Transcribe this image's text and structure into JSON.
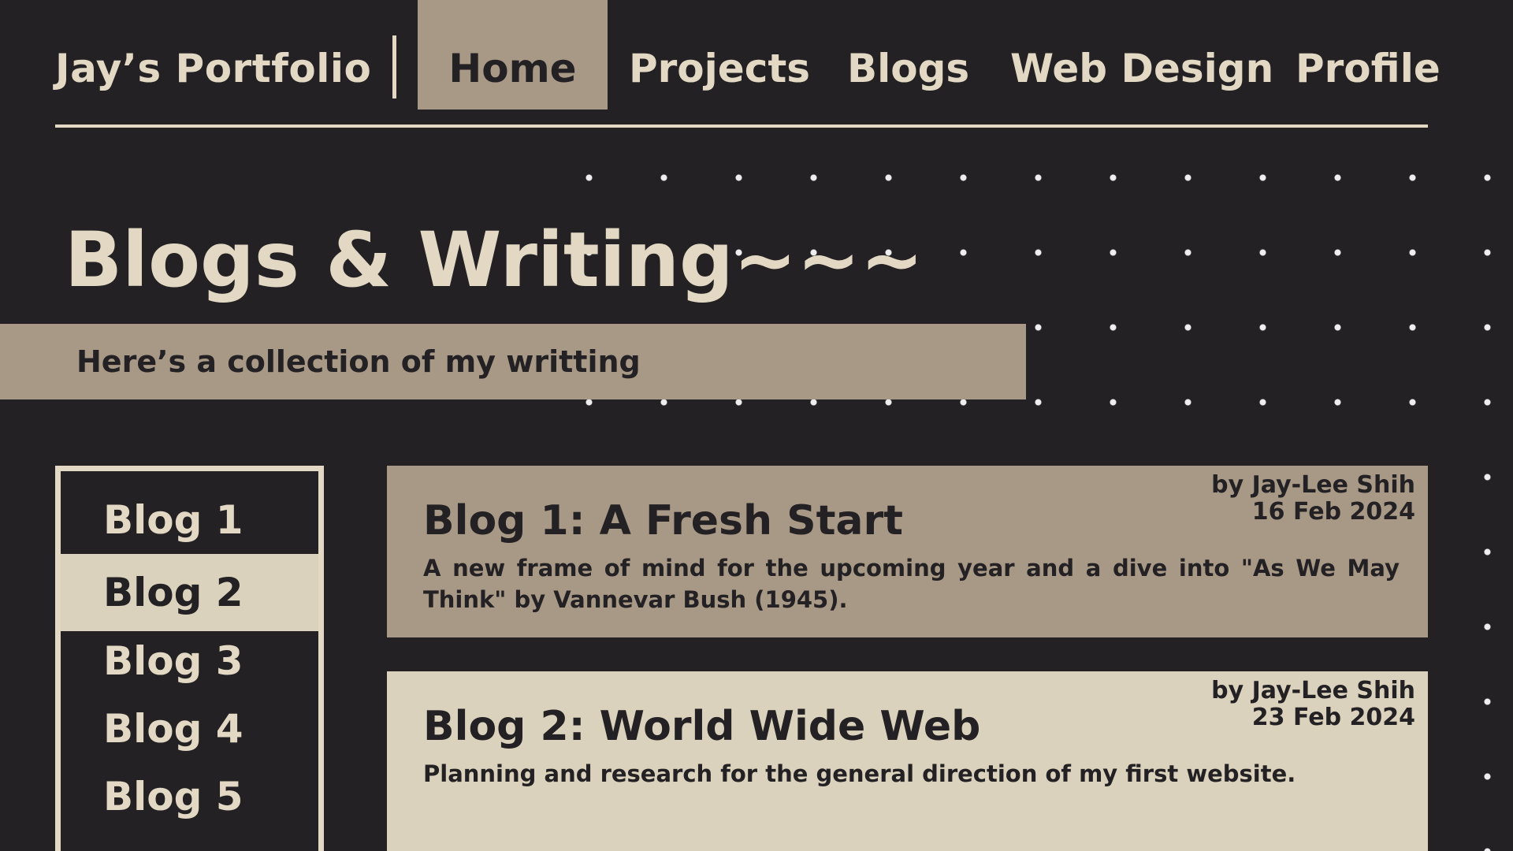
{
  "nav": {
    "brand": "Jay’s Portfolio",
    "items": [
      {
        "label": "Home",
        "active": true
      },
      {
        "label": "Projects",
        "active": false
      },
      {
        "label": "Blogs",
        "active": false
      },
      {
        "label": "Web Design",
        "active": false
      },
      {
        "label": "Profile",
        "active": false
      }
    ]
  },
  "hero": {
    "title": "Blogs & Writing~~~",
    "subtitle": "Here’s a collection of my writting"
  },
  "sidebar": {
    "items": [
      {
        "label": "Blog 1",
        "active": false
      },
      {
        "label": "Blog 2",
        "active": true
      },
      {
        "label": "Blog 3",
        "active": false
      },
      {
        "label": "Blog 4",
        "active": false
      },
      {
        "label": "Blog 5",
        "active": false
      }
    ]
  },
  "posts": [
    {
      "title": "Blog 1: A Fresh Start",
      "author": "by Jay-Lee Shih",
      "date": "16 Feb 2024",
      "description": "A new frame of mind for the upcoming year and a dive into \"As We May Think\" by Vannevar Bush (1945)."
    },
    {
      "title": "Blog 2: World Wide Web",
      "author": "by Jay-Lee Shih",
      "date": "23 Feb 2024",
      "description": "Planning and research for the general direction of my first website."
    }
  ],
  "colors": {
    "background": "#232123",
    "cream": "#e2d8c3",
    "taupe": "#a89886",
    "light_card": "#dbd2bd"
  }
}
